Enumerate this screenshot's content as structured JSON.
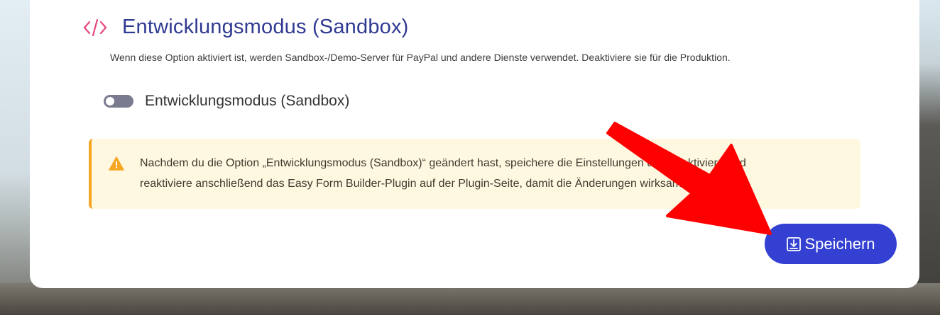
{
  "section": {
    "title": "Entwicklungsmodus (Sandbox)",
    "description": "Wenn diese Option aktiviert ist, werden Sandbox-/Demo-Server für PayPal und andere Dienste verwendet. Deaktiviere sie für die Produktion."
  },
  "toggle": {
    "label": "Entwicklungsmodus (Sandbox)",
    "state": "off"
  },
  "notice": {
    "line1": "Nachdem du die Option „Entwicklungsmodus (Sandbox)“ geändert hast, speichere die Einstellungen und deaktiviere und",
    "line2": "reaktiviere anschließend das Easy Form Builder-Plugin auf der Plugin-Seite, damit die Änderungen wirksam werden."
  },
  "save_button": {
    "label": "Speichern"
  },
  "colors": {
    "title": "#2f3a91",
    "code_icon": "#e8467c",
    "button": "#3340d1",
    "warning": "#f5a623",
    "arrow": "#ff0000"
  },
  "icons": [
    "code-icon",
    "warning-icon",
    "save-icon",
    "arrow-annotation"
  ]
}
